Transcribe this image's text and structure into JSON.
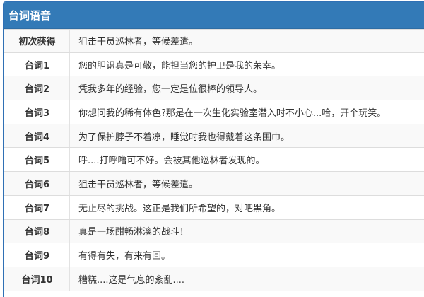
{
  "panel": {
    "title": "台词语音"
  },
  "rows": [
    {
      "label": "初次获得",
      "text": "狙击干员巡林者，等候差遣。"
    },
    {
      "label": "台词1",
      "text": "您的胆识真是可敬，能担当您的护卫是我的荣幸。"
    },
    {
      "label": "台词2",
      "text": "凭我多年的经验，您一定是位很棒的领导人。"
    },
    {
      "label": "台词3",
      "text": "你想问我的稀有体色?那是在一次生化实验室潜入时不小心...哈，开个玩笑。"
    },
    {
      "label": "台词4",
      "text": "为了保护脖子不着凉，睡觉时我也得戴着这条围巾。"
    },
    {
      "label": "台词5",
      "text": "呼....打呼噜可不好。会被其他巡林者发现的。"
    },
    {
      "label": "台词6",
      "text": "狙击干员巡林者，等候差遣。"
    },
    {
      "label": "台词7",
      "text": "无止尽的挑战。这正是我们所希望的，对吧黑角。"
    },
    {
      "label": "台词8",
      "text": "真是一场酣畅淋漓的战斗！"
    },
    {
      "label": "台词9",
      "text": "有得有失，有来有回。"
    },
    {
      "label": "台词10",
      "text": "糟糕....这是气息的紊乱...."
    }
  ]
}
